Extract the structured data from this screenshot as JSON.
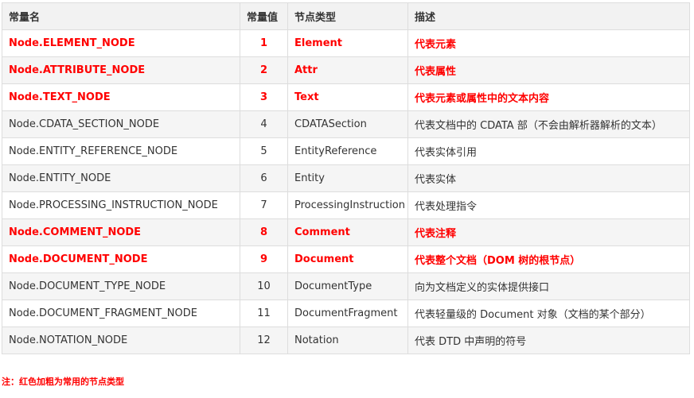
{
  "table": {
    "headers": [
      "常量名",
      "常量值",
      "节点类型",
      "描述"
    ],
    "rows": [
      {
        "name": "Node.ELEMENT_NODE",
        "value": "1",
        "type": "Element",
        "desc": "代表元素",
        "highlight": true
      },
      {
        "name": "Node.ATTRIBUTE_NODE",
        "value": "2",
        "type": "Attr",
        "desc": "代表属性",
        "highlight": true
      },
      {
        "name": "Node.TEXT_NODE",
        "value": "3",
        "type": "Text",
        "desc": "代表元素或属性中的文本内容",
        "highlight": true
      },
      {
        "name": "Node.CDATA_SECTION_NODE",
        "value": "4",
        "type": "CDATASection",
        "desc": "代表文档中的 CDATA 部（不会由解析器解析的文本）",
        "highlight": false
      },
      {
        "name": "Node.ENTITY_REFERENCE_NODE",
        "value": "5",
        "type": "EntityReference",
        "desc": "代表实体引用",
        "highlight": false
      },
      {
        "name": "Node.ENTITY_NODE",
        "value": "6",
        "type": "Entity",
        "desc": "代表实体",
        "highlight": false
      },
      {
        "name": "Node.PROCESSING_INSTRUCTION_NODE",
        "value": "7",
        "type": "ProcessingInstruction",
        "desc": "代表处理指令",
        "highlight": false
      },
      {
        "name": "Node.COMMENT_NODE",
        "value": "8",
        "type": "Comment",
        "desc": "代表注释",
        "highlight": true
      },
      {
        "name": "Node.DOCUMENT_NODE",
        "value": "9",
        "type": "Document",
        "desc": "代表整个文档（DOM 树的根节点）",
        "highlight": true
      },
      {
        "name": "Node.DOCUMENT_TYPE_NODE",
        "value": "10",
        "type": "DocumentType",
        "desc": "向为文档定义的实体提供接口",
        "highlight": false
      },
      {
        "name": "Node.DOCUMENT_FRAGMENT_NODE",
        "value": "11",
        "type": "DocumentFragment",
        "desc": "代表轻量级的 Document 对象（文档的某个部分）",
        "highlight": false
      },
      {
        "name": "Node.NOTATION_NODE",
        "value": "12",
        "type": "Notation",
        "desc": "代表 DTD 中声明的符号",
        "highlight": false
      }
    ]
  },
  "note": "注：红色加粗为常用的节点类型",
  "colors": {
    "highlight": "#ff0000",
    "stripe": "#f5f5f5",
    "header": "#f2f2f2",
    "border": "#dddddd"
  }
}
